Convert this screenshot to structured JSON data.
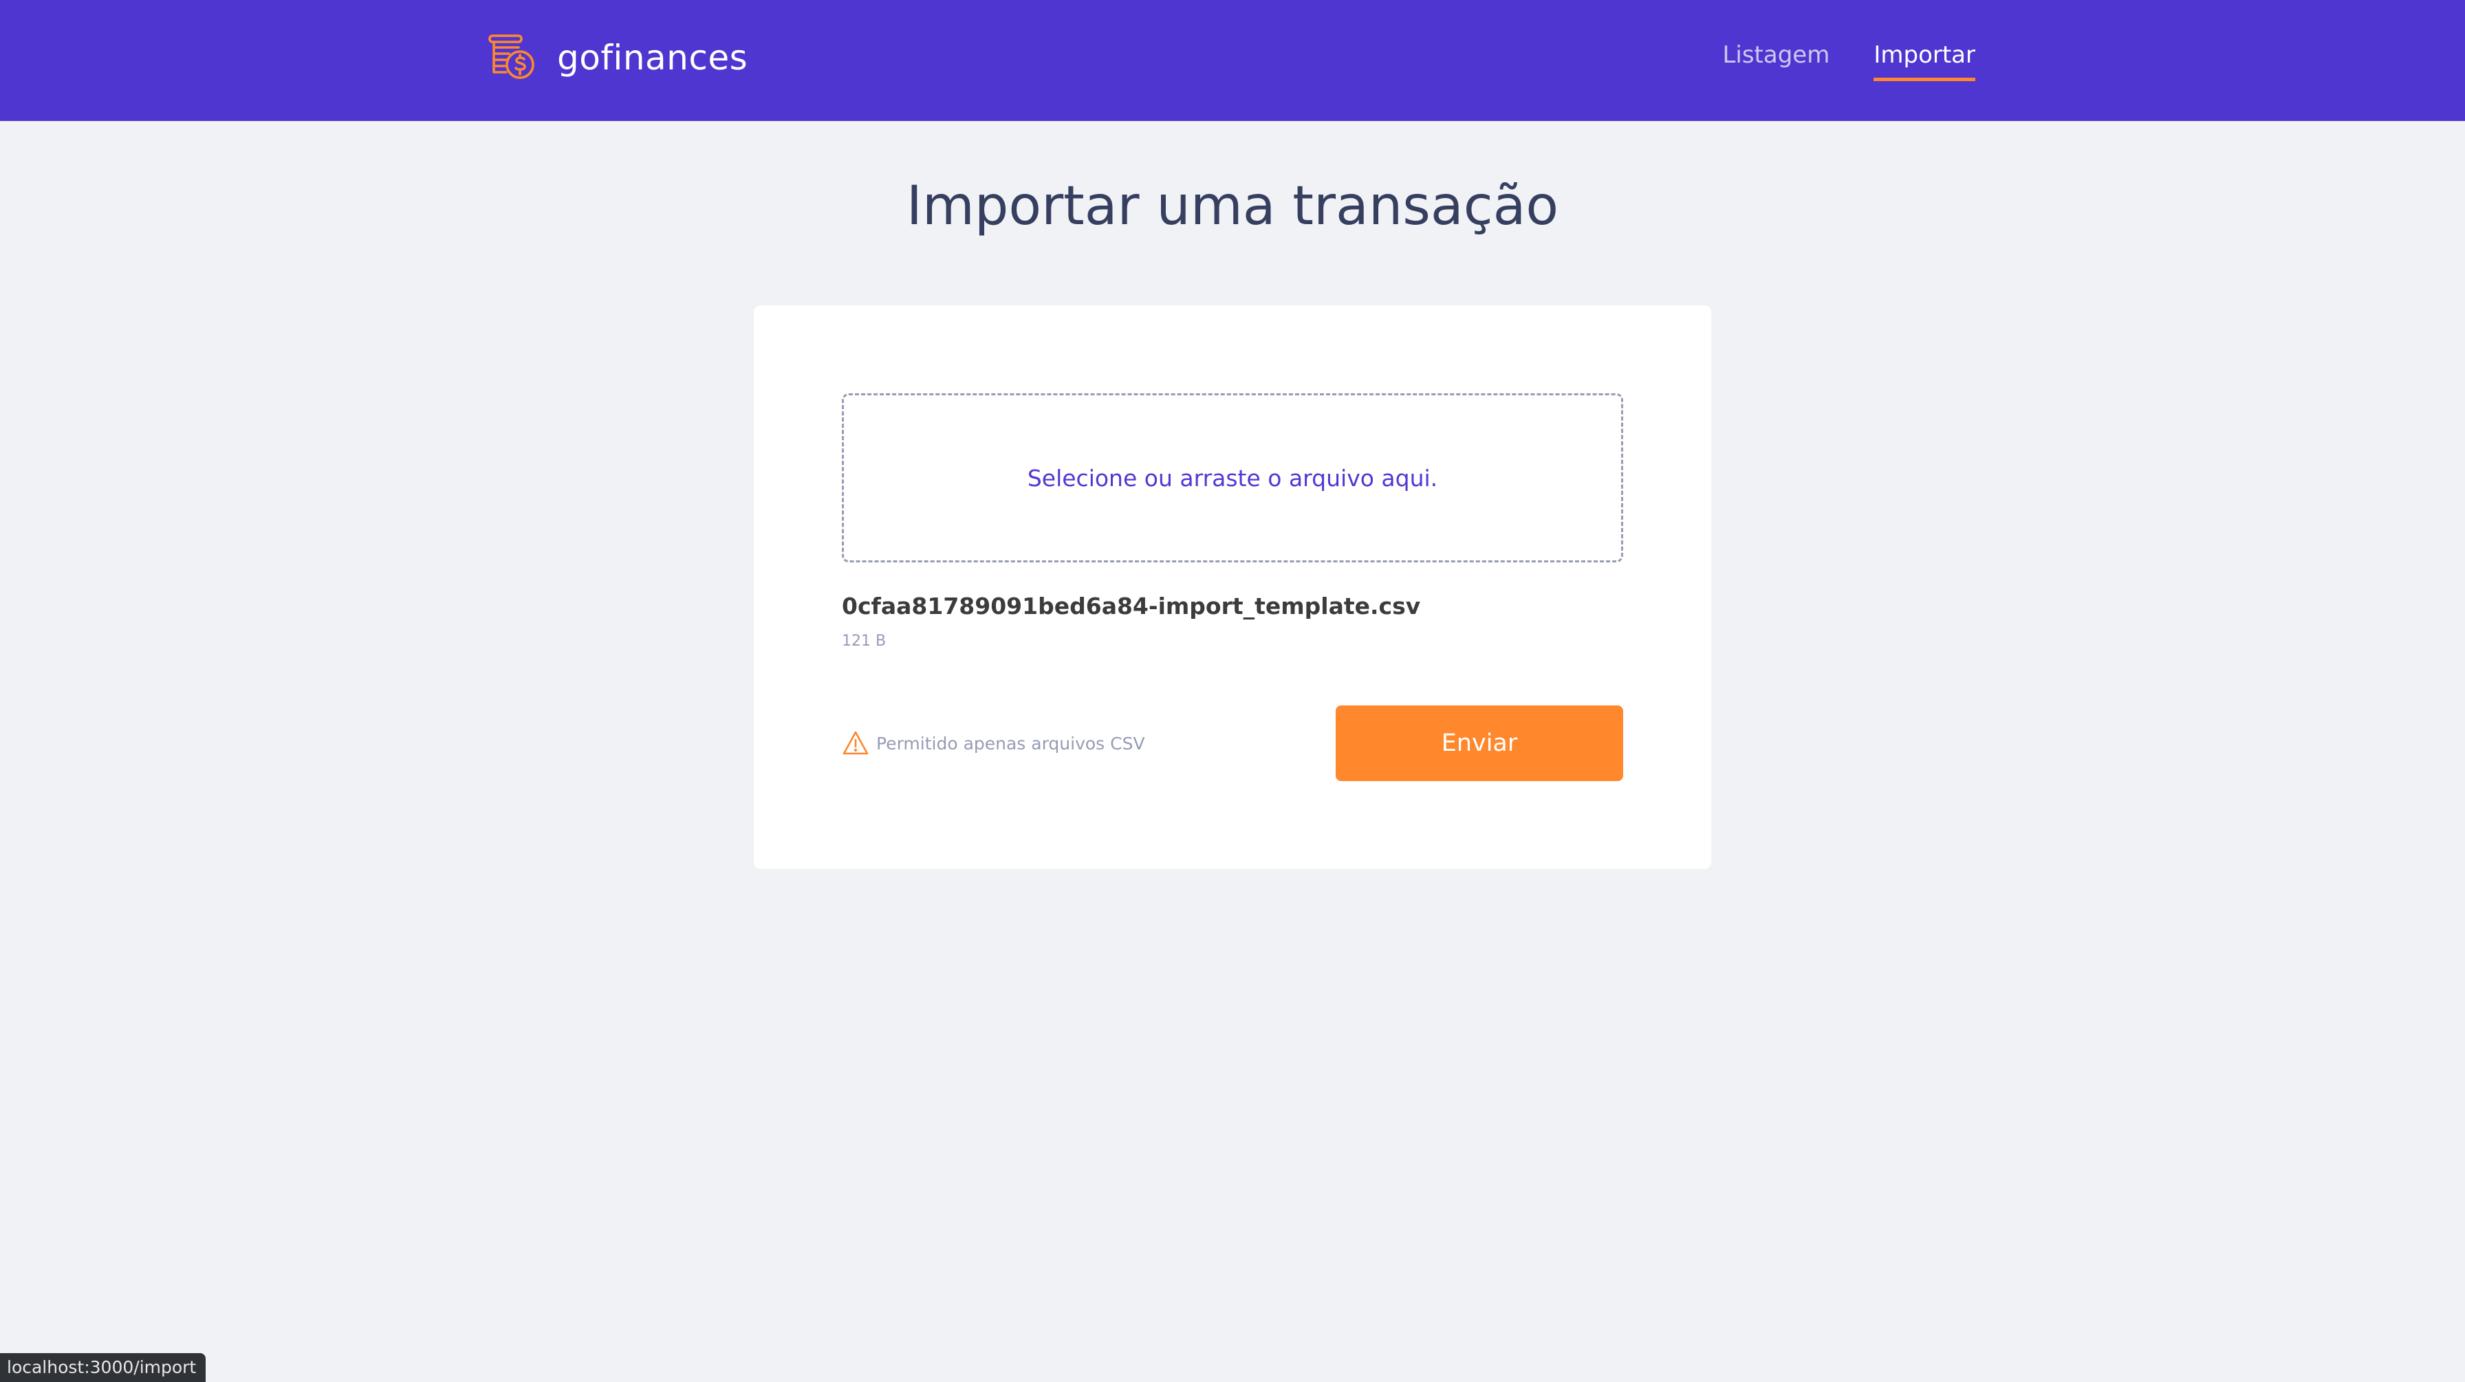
{
  "app": {
    "logo_alt": "coins-dollar-icon",
    "name": "gofinances"
  },
  "nav": {
    "items": [
      {
        "label": "Listagem",
        "active": false
      },
      {
        "label": "Importar",
        "active": true
      }
    ]
  },
  "page": {
    "title": "Importar uma transação"
  },
  "upload": {
    "dropzone_text": "Selecione ou arraste o arquivo aqui.",
    "file_name": "0cfaa81789091bed6a84-import_template.csv",
    "file_size": "121 B",
    "hint_icon": "warning-icon",
    "hint_text": "Permitido apenas arquivos CSV",
    "submit_label": "Enviar"
  },
  "status_bar": {
    "url": "localhost:3000/import"
  },
  "colors": {
    "header_bg": "#5036D0",
    "accent": "#FF872C",
    "page_bg": "#F0F2F5",
    "title_text": "#363F5F",
    "dropzone_text": "#5636D3",
    "muted_text": "#969CB3"
  }
}
